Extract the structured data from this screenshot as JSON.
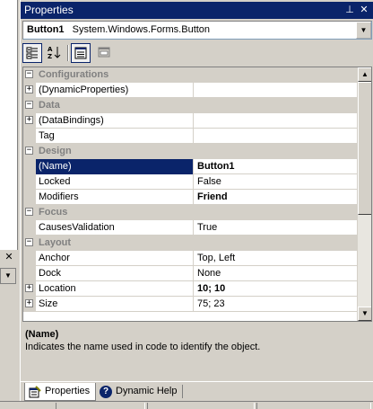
{
  "window": {
    "title": "Properties",
    "pin_glyph": "⊥",
    "close_glyph": "✕"
  },
  "object_selector": {
    "name": "Button1",
    "type": "System.Windows.Forms.Button"
  },
  "toolbar": {
    "buttons": [
      {
        "icon": "categorized-icon",
        "pressed": true
      },
      {
        "icon": "alphabetical-icon",
        "pressed": false
      },
      {
        "icon": "properties-icon",
        "pressed": true
      },
      {
        "icon": "property-pages-icon",
        "pressed": false
      }
    ]
  },
  "grid": {
    "rows": [
      {
        "kind": "category",
        "label": "Configurations",
        "expander": "−"
      },
      {
        "kind": "prop",
        "name": "(DynamicProperties)",
        "value": "",
        "expander": "+"
      },
      {
        "kind": "category",
        "label": "Data",
        "expander": "−"
      },
      {
        "kind": "prop",
        "name": "(DataBindings)",
        "value": "",
        "expander": "+"
      },
      {
        "kind": "prop",
        "name": "Tag",
        "value": ""
      },
      {
        "kind": "category",
        "label": "Design",
        "expander": "−"
      },
      {
        "kind": "prop",
        "name": "(Name)",
        "value": "Button1",
        "bold": true,
        "selected": true
      },
      {
        "kind": "prop",
        "name": "Locked",
        "value": "False"
      },
      {
        "kind": "prop",
        "name": "Modifiers",
        "value": "Friend",
        "bold": true
      },
      {
        "kind": "category",
        "label": "Focus",
        "expander": "−"
      },
      {
        "kind": "prop",
        "name": "CausesValidation",
        "value": "True"
      },
      {
        "kind": "category",
        "label": "Layout",
        "expander": "−"
      },
      {
        "kind": "prop",
        "name": "Anchor",
        "value": "Top, Left"
      },
      {
        "kind": "prop",
        "name": "Dock",
        "value": "None"
      },
      {
        "kind": "prop",
        "name": "Location",
        "value": "10; 10",
        "bold": true,
        "expander": "+"
      },
      {
        "kind": "prop",
        "name": "Size",
        "value": "75; 23",
        "expander": "+"
      }
    ]
  },
  "description": {
    "title": "(Name)",
    "text": "Indicates the name used in code to identify the object."
  },
  "tabs": [
    {
      "label": "Properties",
      "icon": "properties-tab-icon",
      "active": true
    },
    {
      "label": "Dynamic Help",
      "icon": "help-icon",
      "active": false
    }
  ],
  "colors": {
    "titlebar": "#0a246a",
    "selection": "#0a246a",
    "face": "#d4d0c8"
  }
}
